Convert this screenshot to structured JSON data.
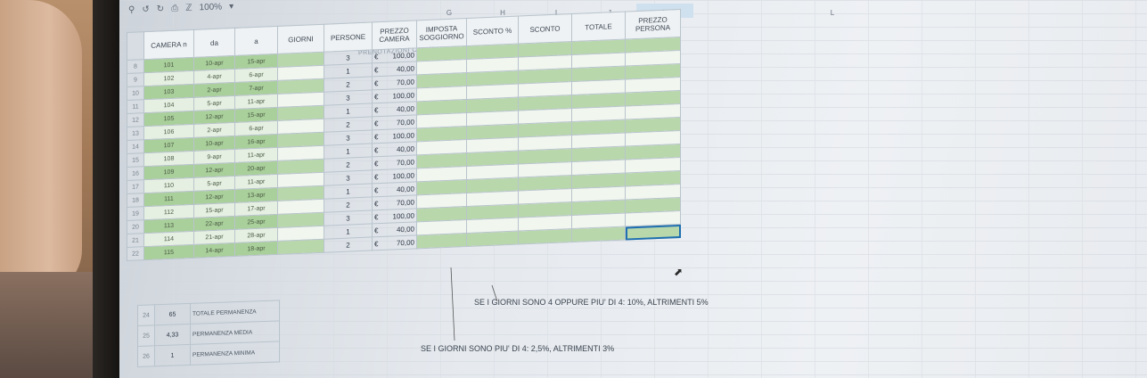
{
  "toolbar": {
    "zoom": "100%"
  },
  "columns": [
    "G",
    "H",
    "I",
    "J",
    "K",
    "L"
  ],
  "sheet": {
    "title": "PRENOTAZIONI CAMERE",
    "headers": [
      "CAMERA n",
      "da",
      "a",
      "GIORNI",
      "PERSONE",
      "PREZZO CAMERA",
      "IMPOSTA SOGGIORNO",
      "SCONTO %",
      "SCONTO",
      "TOTALE",
      "PREZZO PERSONA"
    ],
    "rows": [
      {
        "camera": "101",
        "da": "10-apr",
        "a": "15-apr",
        "giorni": "",
        "persone": "3",
        "valuta": "€",
        "prezzo": "100,00"
      },
      {
        "camera": "102",
        "da": "4-apr",
        "a": "6-apr",
        "giorni": "",
        "persone": "1",
        "valuta": "€",
        "prezzo": "40,00"
      },
      {
        "camera": "103",
        "da": "2-apr",
        "a": "7-apr",
        "giorni": "",
        "persone": "2",
        "valuta": "€",
        "prezzo": "70,00"
      },
      {
        "camera": "104",
        "da": "5-apr",
        "a": "11-apr",
        "giorni": "",
        "persone": "3",
        "valuta": "€",
        "prezzo": "100,00"
      },
      {
        "camera": "105",
        "da": "12-apr",
        "a": "15-apr",
        "giorni": "",
        "persone": "1",
        "valuta": "€",
        "prezzo": "40,00"
      },
      {
        "camera": "106",
        "da": "2-apr",
        "a": "6-apr",
        "giorni": "",
        "persone": "2",
        "valuta": "€",
        "prezzo": "70,00"
      },
      {
        "camera": "107",
        "da": "10-apr",
        "a": "16-apr",
        "giorni": "",
        "persone": "3",
        "valuta": "€",
        "prezzo": "100,00"
      },
      {
        "camera": "108",
        "da": "9-apr",
        "a": "11-apr",
        "giorni": "",
        "persone": "1",
        "valuta": "€",
        "prezzo": "40,00"
      },
      {
        "camera": "109",
        "da": "12-apr",
        "a": "20-apr",
        "giorni": "",
        "persone": "2",
        "valuta": "€",
        "prezzo": "70,00"
      },
      {
        "camera": "110",
        "da": "5-apr",
        "a": "11-apr",
        "giorni": "",
        "persone": "3",
        "valuta": "€",
        "prezzo": "100,00"
      },
      {
        "camera": "111",
        "da": "12-apr",
        "a": "13-apr",
        "giorni": "",
        "persone": "1",
        "valuta": "€",
        "prezzo": "40,00"
      },
      {
        "camera": "112",
        "da": "15-apr",
        "a": "17-apr",
        "giorni": "",
        "persone": "2",
        "valuta": "€",
        "prezzo": "70,00"
      },
      {
        "camera": "113",
        "da": "22-apr",
        "a": "25-apr",
        "giorni": "",
        "persone": "3",
        "valuta": "€",
        "prezzo": "100,00"
      },
      {
        "camera": "114",
        "da": "21-apr",
        "a": "28-apr",
        "giorni": "",
        "persone": "1",
        "valuta": "€",
        "prezzo": "40,00"
      },
      {
        "camera": "115",
        "da": "14-apr",
        "a": "18-apr",
        "giorni": "",
        "persone": "2",
        "valuta": "€",
        "prezzo": "70,00"
      }
    ]
  },
  "summary": [
    {
      "value": "65",
      "label": "TOTALE PERMANENZA"
    },
    {
      "value": "4,33",
      "label": "PERMANENZA MEDIA"
    },
    {
      "value": "1",
      "label": "PERMANENZA MINIMA"
    }
  ],
  "notes": {
    "sconto": "SE I GIORNI SONO 4 OPPURE PIU' DI 4:  10%, ALTRIMENTI 5%",
    "imposta": "SE I GIORNI SONO PIU' DI 4:  2,5%, ALTRIMENTI 3%"
  },
  "colors": {
    "green_band": "#a9cf9a",
    "light_band": "#e6f0e2",
    "selection": "#1f6fb0"
  }
}
